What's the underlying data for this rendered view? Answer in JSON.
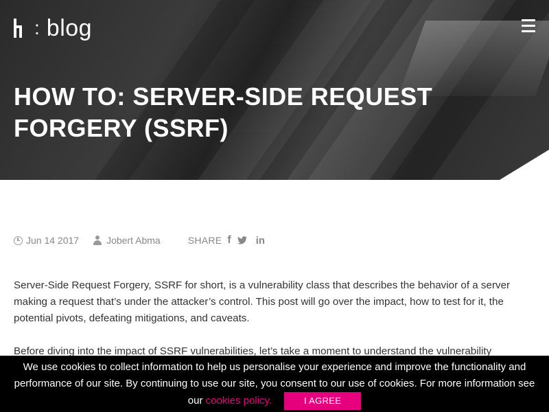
{
  "header": {
    "logo_colon": ":",
    "logo_text": "blog"
  },
  "post": {
    "title": "HOW TO: SERVER-SIDE REQUEST FORGERY (SSRF)",
    "date": "Jun 14 2017",
    "author": "Jobert Abma",
    "share_label": "SHARE",
    "social": {
      "facebook": "f",
      "linkedin": "in"
    },
    "paragraphs": [
      "Server-Side Request Forgery, SSRF for short, is a vulnerability class that describes the behavior of a server making a request that’s under the attacker’s control. This post will go over the impact, how to test for it, the potential pivots, defeating mitigations, and caveats.",
      "Before diving into the impact of SSRF vulnerabilities, let’s take a moment to understand the vulnerability"
    ]
  },
  "cookie_banner": {
    "text": "We use cookies to collect information to help us personalise your experience and improve the functionality and performance of our site. By continuing to use our site, you consent to our use of cookies. For more information see our ",
    "link_label": "cookies policy.",
    "agree_label": "I AGREE"
  },
  "colors": {
    "accent": "#e6007e",
    "banner_bg": "#000000",
    "meta_text": "#888888"
  },
  "icons": {
    "menu": "hamburger-menu-icon",
    "date": "clock-icon",
    "author": "user-icon",
    "share": [
      "facebook-icon",
      "twitter-icon",
      "linkedin-icon"
    ]
  }
}
